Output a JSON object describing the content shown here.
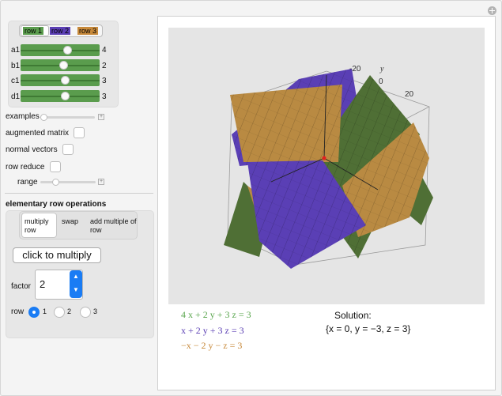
{
  "controls": {
    "row_tabs": [
      {
        "label": "row 1",
        "color": "#5a9c4d",
        "selected": true
      },
      {
        "label": "row 2",
        "color": "#5b3fb4",
        "selected": false
      },
      {
        "label": "row 3",
        "color": "#c7893a",
        "selected": false
      }
    ],
    "sliders": [
      {
        "label": "a1",
        "value": "4",
        "position": 0.6
      },
      {
        "label": "b1",
        "value": "2",
        "position": 0.53
      },
      {
        "label": "c1",
        "value": "3",
        "position": 0.56
      },
      {
        "label": "d1",
        "value": "3",
        "position": 0.56
      }
    ],
    "examples_label": "examples",
    "augmented_matrix_label": "augmented matrix",
    "normal_vectors_label": "normal vectors",
    "row_reduce_label": "row reduce",
    "range_label": "range"
  },
  "operations": {
    "title": "elementary row operations",
    "tabs": [
      "multiply row",
      "swap",
      "add multiple of row"
    ],
    "selected_tab": "multiply row",
    "multiply_button": "click to multiply",
    "factor_label": "factor",
    "factor_value": "2",
    "row_label": "row",
    "row_options": [
      "1",
      "2",
      "3"
    ],
    "row_selected": "1"
  },
  "plot": {
    "axis_label": "y",
    "ticks": [
      "-20",
      "0",
      "20"
    ],
    "colors": {
      "plane1": "#4f6f35",
      "plane2": "#5a3fb5",
      "plane3": "#b98a42"
    }
  },
  "equations": [
    {
      "text": "4 x + 2 y + 3 z = 3",
      "color": "#5aa64e"
    },
    {
      "text": "x + 2 y + 3 z = 3",
      "color": "#5b3fb4"
    },
    {
      "text": "−x − 2 y − z = 3",
      "color": "#c7893a"
    }
  ],
  "solution": {
    "title": "Solution:",
    "value": "{x = 0, y = −3, z = 3}"
  }
}
